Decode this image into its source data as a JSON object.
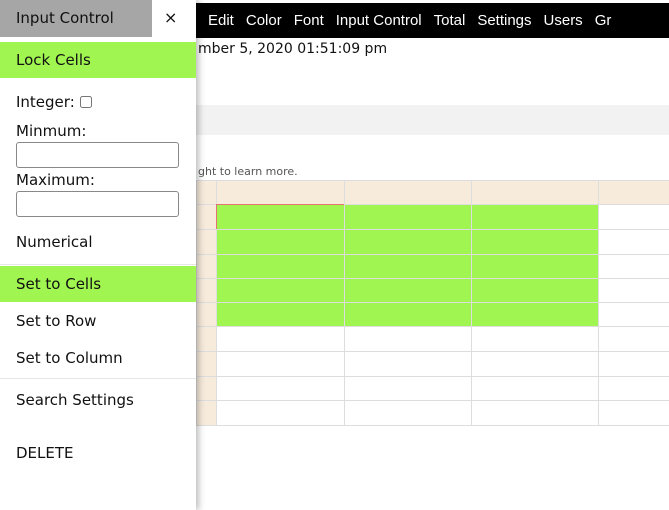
{
  "menu": [
    "Edit",
    "Color",
    "Font",
    "Input Control",
    "Total",
    "Settings",
    "Users",
    "Gr"
  ],
  "date_text": "mber 5, 2020 01:51:09 pm",
  "hint": "ght to learn more.",
  "panel": {
    "title": "Input Control",
    "close": "×",
    "lock": "Lock Cells",
    "integer": "Integer:",
    "min": "Minmum:",
    "max": "Maximum:",
    "numerical": "Numerical",
    "set_cells": "Set to Cells",
    "set_row": "Set to Row",
    "set_col": "Set to Column",
    "search": "Search Settings",
    "delete": "DELETE",
    "min_value": "",
    "max_value": ""
  },
  "colors": {
    "green": "#a0f550",
    "header": "#f7ebdc",
    "selected_border": "#e57373"
  }
}
